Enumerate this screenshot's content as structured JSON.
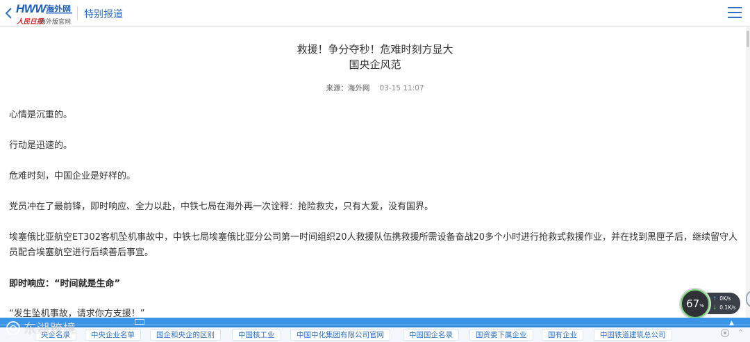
{
  "header": {
    "logo_hww": "HWW",
    "logo_cn": "海外网",
    "logo_rm": "人民日报",
    "logo_sub": "海外版官网",
    "section_title": "特别报道"
  },
  "article": {
    "title_line1": "救援！争分夺秒！危难时刻方显大",
    "title_line2": "国央企风范",
    "source": "来源：海外网",
    "time": "03-15 11:07",
    "paragraphs": [
      "心情是沉重的。",
      "行动是迅速的。",
      "危难时刻，中国企业是好样的。",
      "党员冲在了最前锋，即时响应、全力以赴，中铁七局在海外再一次诠释：抢险救灾，只有大爱，没有国界。",
      "埃塞俄比亚航空ET302客机坠机事故中，中铁七局埃塞俄比亚分公司第一时间组织20人救援队伍携救援所需设备奋战20多个小时进行抢救式救援作业，并在找到黑匣子后，继续留守人员配合埃塞航空进行后续善后事宜。",
      "即时响应：“时间就是生命”",
      "“发生坠机事故，请求你方支援！”"
    ]
  },
  "gauge": {
    "percent": "67",
    "percent_unit": "%",
    "upload": "0K/s",
    "download": "0.1K/s"
  },
  "watermark": {
    "text": "东湖跨境"
  },
  "tags": [
    "央企名录",
    "中央企业名单",
    "国企和央企的区别",
    "中国核工业",
    "中国中化集团有限公司官网",
    "中国国企名录",
    "国资委下属企业",
    "国有企业",
    "中国铁道建筑总公司"
  ],
  "colors": {
    "brand_blue": "#2d6fc3",
    "bar_blue": "#2f8ae0",
    "logo_red": "#e23b2e"
  }
}
